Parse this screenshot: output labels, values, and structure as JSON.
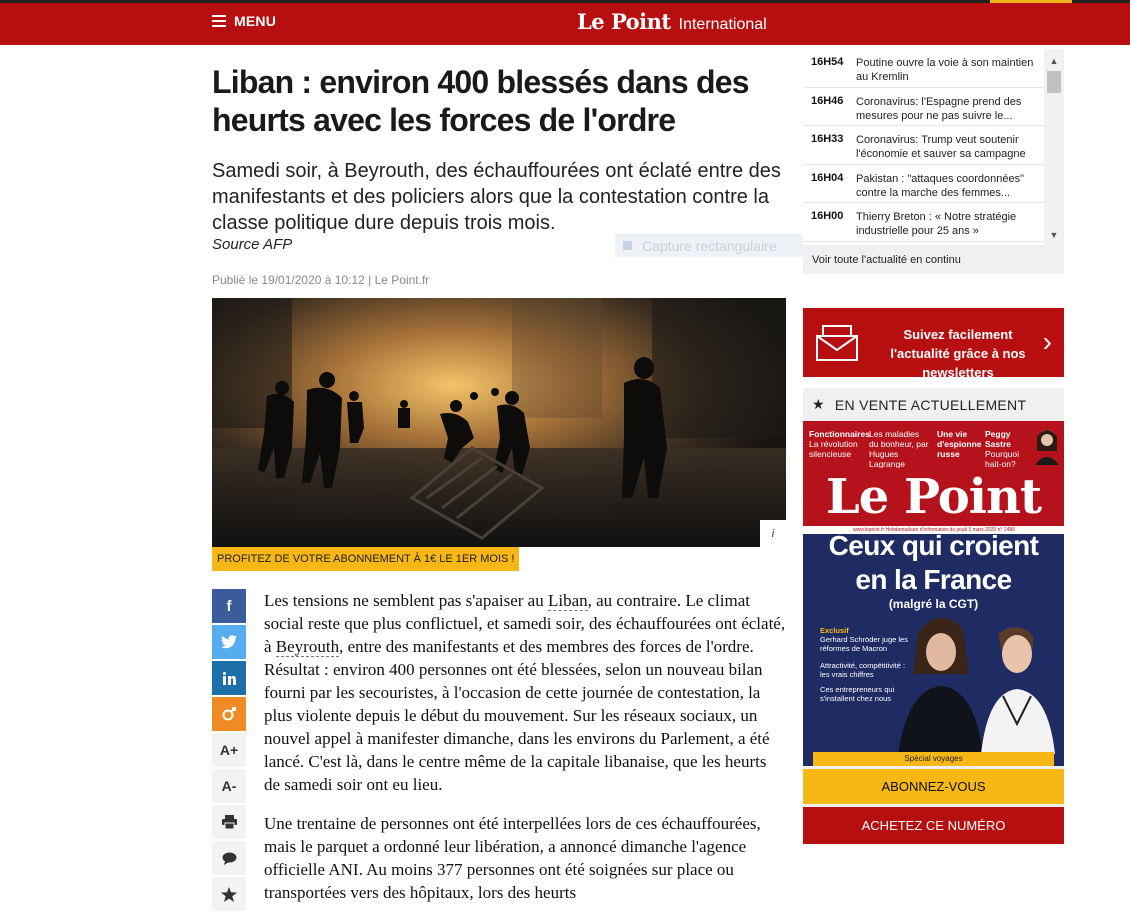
{
  "header": {
    "menu_label": "MENU",
    "brand": "Le Point",
    "section": "International"
  },
  "article": {
    "headline": "Liban : environ 400 blessés dans des heurts avec les forces de l'ordre",
    "chapo": "Samedi soir, à Beyrouth, des échauffourées ont éclaté entre des manifestants et des policiers alors que la contestation contre la classe politique dure depuis trois mois.",
    "source": "Source AFP",
    "published": "Publié le 19/01/2020 à 10:12 | Le Point.fr",
    "image_info": "i",
    "promo_strip": "PROFITEZ DE VOTRE ABONNEMENT À 1€ LE 1ER MOIS !",
    "p1_a": "Les tensions ne semblent pas s'apaiser au ",
    "p1_link1": "Liban",
    "p1_b": ", au contraire. Le climat social reste que plus conflictuel, et samedi soir, des échauffourées ont éclaté, à ",
    "p1_link2": "Beyrouth",
    "p1_c": ", entre des manifestants et des membres des forces de l'ordre. Résultat : environ 400 personnes ont été blessées, selon un nouveau bilan fourni par les secouristes, à l'occasion de cette journée de contestation, la plus violente depuis le début du mouvement. Sur les réseaux sociaux, un nouvel appel à manifester dimanche, dans les environs du Parlement, a été lancé. C'est là, dans le centre même de la capitale libanaise, que les heurts de samedi soir ont eu lieu.",
    "p2": "Une trentaine de personnes ont été interpellées lors de ces échauffourées, mais le parquet a ordonné leur libération, a annoncé dimanche l'agence officielle ANI. Au moins 377 personnes ont été soignées sur place ou transportées vers des hôpitaux, lors des heurts"
  },
  "overlay": {
    "capture_label": "Capture rectangulaire"
  },
  "share": {
    "facebook_glyph": "f",
    "font_plus": "A+",
    "font_minus": "A-"
  },
  "flash": {
    "items": [
      {
        "time": "16H54",
        "title": "Poutine ouvre la voie à son maintien au Kremlin"
      },
      {
        "time": "16H46",
        "title": "Coronavirus: l'Espagne prend des mesures pour ne pas suivre le..."
      },
      {
        "time": "16H33",
        "title": "Coronavirus: Trump veut soutenir l'économie et sauver sa campagne"
      },
      {
        "time": "16H04",
        "title": "Pakistan : \"attaques coordonnées\" contre la marche des femmes..."
      },
      {
        "time": "16H00",
        "title": "Thierry Breton : « Notre stratégie industrielle pour 25 ans »"
      }
    ],
    "footer": "Voir toute l'actualité en continu"
  },
  "newsletter": {
    "text": "Suivez facilement l'actualité grâce à nos newsletters"
  },
  "onsale": {
    "title": "EN VENTE ACTUELLEMENT",
    "subscribe": "ABONNEZ-VOUS",
    "buy": "ACHETEZ CE NUMÉRO"
  },
  "cover": {
    "teaser1_a": "Fonctionnaires",
    "teaser1_b": "La révolution silencieuse",
    "teaser2_a": "Les maladies",
    "teaser2_b": "du bonheur, par Hugues Lagrange",
    "teaser3_a": "Une vie",
    "teaser3_b": "d'espionne russe",
    "teaser4_a": "Peggy Sastre",
    "teaser4_b": "Pourquoi hait-on?",
    "masthead": "Le Point",
    "strip": "www.lepoint.fr  Hebdomadaire d'information du jeudi 5 mars 2020  n° 2480",
    "title_line1": "Ceux qui croient",
    "title_line2": "en la France",
    "subtitle": "(malgré la CGT)",
    "excl": "Exclusif",
    "side1": "Gerhard Schröder juge les réformes de Macron",
    "side2": "Attractivité, compétitivité : les vrais chiffres",
    "side3": "Ces entrepreneurs qui s'installent chez nous",
    "bottom": "Spécial voyages"
  },
  "colors": {
    "brand_red": "#b70f0f",
    "accent_yellow": "#f7b715",
    "facebook": "#3b5c9a",
    "twitter": "#55acee",
    "linkedin": "#1c6fa8",
    "flipboard": "#f08a24"
  },
  "icons": [
    "menu-icon",
    "facebook-icon",
    "twitter-icon",
    "linkedin-icon",
    "share-icon",
    "font-increase-icon",
    "font-decrease-icon",
    "print-icon",
    "comment-icon",
    "star-icon",
    "envelope-icon",
    "chevron-right-icon",
    "info-icon"
  ]
}
